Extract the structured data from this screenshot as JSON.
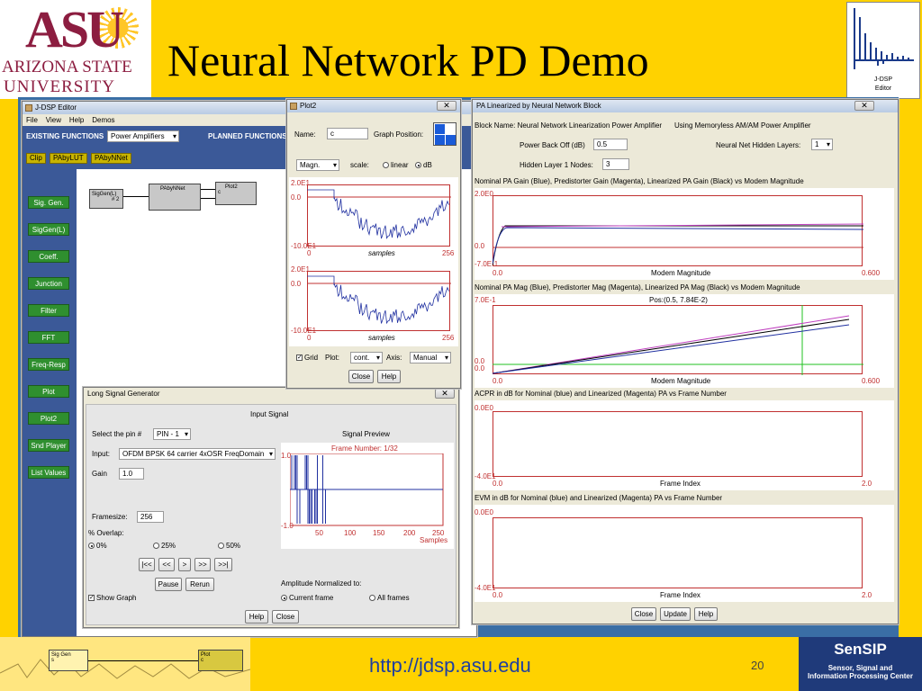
{
  "slide": {
    "title": "Neural Network PD Demo",
    "url": "http://jdsp.asu.edu",
    "page_number": "20"
  },
  "logos": {
    "asu_mark": "ASU",
    "asu_line1": "ARIZONA STATE",
    "asu_line2": "UNIVERSITY",
    "jdsp_line1": "J-DSP",
    "jdsp_line2": "Editor",
    "sensip_mark": "SenSIP",
    "sensip_line1": "Sensor, Signal and",
    "sensip_line2": "Information Processing Center"
  },
  "footer_strip": {
    "block1_name": "Sig Gen",
    "block1_sub": "s",
    "block2_name": "Plot",
    "block2_sub": "c"
  },
  "editor": {
    "title": "J-DSP Editor",
    "menu": [
      "File",
      "View",
      "Help",
      "Demos"
    ],
    "existing_label": "EXISTING FUNCTIONS",
    "function_select": "Power Amplifiers",
    "planned_label": "PLANNED FUNCTIONS",
    "tools": [
      "Clip",
      "PAbyLUT",
      "PAbyNNet"
    ],
    "sidebar": [
      "Sig. Gen.",
      "SigGen(L)",
      "Coeff.",
      "Junction",
      "Filter",
      "FFT",
      "Freq-Resp",
      "Plot",
      "Plot2",
      "Snd Player",
      "List Values"
    ],
    "blocks": {
      "siggen": "SigGen(L)",
      "siggen_pin": "# 2",
      "pabynnet": "PAbyNNet",
      "plot2": "Plot2",
      "plot2_sub": "c"
    }
  },
  "plot2": {
    "title": "Plot2",
    "name_label": "Name:",
    "name_value": "c",
    "graph_position_label": "Graph Position:",
    "mode_select": "Magn.",
    "scale_label": "scale:",
    "scale_options": [
      "linear",
      "dB"
    ],
    "scale_selected": "dB",
    "top_y_max": "2.0E1",
    "top_y_mid": "0.0",
    "top_y_min": "-10.0E1",
    "x_start": "0",
    "x_label": "samples",
    "x_end": "256",
    "grid_label": "Grid",
    "plot_label": "Plot:",
    "plot_select": "cont.",
    "axis_label": "Axis:",
    "axis_select": "Manual",
    "close": "Close",
    "help": "Help"
  },
  "pa_window": {
    "title": "PA Linearized by Neural Network Block",
    "block_name": "Block Name: Neural Network Linearization Power Amplifier",
    "using": "Using Memoryless AM/AM Power Amplifier",
    "power_backoff_label": "Power Back Off (dB)",
    "power_backoff_value": "0.5",
    "hidden_layers_label": "Neural Net Hidden Layers:",
    "hidden_layers_value": "1",
    "hidden_nodes_label": "Hidden Layer 1 Nodes:",
    "hidden_nodes_value": "3",
    "plots": [
      {
        "title": "Nominal PA Gain (Blue), Predistorter Gain (Magenta), Linearized PA Gain (Black) vs Modem Magnitude",
        "ymax": "2.0E0",
        "ymid": "0.0",
        "ymin": "-7.0E-1",
        "xstart": "0.0",
        "xlabel": "Modem Magnitude",
        "xend": "0.600"
      },
      {
        "title": "Nominal PA Mag (Blue), Predistorter Mag (Magenta), Linearized PA Mag (Black) vs Modem Magnitude",
        "ymax": "7.0E-1",
        "ymid": "0.0",
        "ymin": "0.0",
        "xstart": "0.0",
        "xlabel": "Modem Magnitude",
        "xend": "0.600",
        "cursor": "Pos:(0.5, 7.84E-2)"
      },
      {
        "title": "ACPR in dB for Nominal (blue) and Linearized (Magenta) PA vs Frame Number",
        "ymax": "0.0E0",
        "ymin": "-4.0E1",
        "xstart": "0.0",
        "xlabel": "Frame Index",
        "xend": "2.0"
      },
      {
        "title": "EVM in dB for Nominal (blue) and Linearized (Magenta) PA vs Frame Number",
        "ymax": "0.0E0",
        "ymin": "-4.0E1",
        "xstart": "0.0",
        "xlabel": "Frame Index",
        "xend": "2.0"
      }
    ],
    "close": "Close",
    "update": "Update",
    "help": "Help"
  },
  "lsg": {
    "title": "Long Signal Generator",
    "input_signal": "Input Signal",
    "select_pin_label": "Select the pin #",
    "pin_value": "PIN - 1",
    "signal_preview": "Signal Preview",
    "input_label": "Input:",
    "input_value": "OFDM BPSK 64 carrier 4xOSR FreqDomain",
    "frame_number": "Frame Number: 1/32",
    "gain_label": "Gain",
    "gain_value": "1.0",
    "framesize_label": "Framesize:",
    "framesize_value": "256",
    "overlap_label": "% Overlap:",
    "overlap_options": [
      "0%",
      "25%",
      "50%"
    ],
    "nav": [
      "|<<",
      "<<",
      ">",
      ">>",
      ">>|"
    ],
    "pause": "Pause",
    "rerun": "Rerun",
    "show_graph": "Show Graph",
    "amp_norm_label": "Amplitude Normalized to:",
    "amp_options": [
      "Current frame",
      "All frames"
    ],
    "y_top": "1.0",
    "y_bottom": "-1.0",
    "x_ticks": [
      "50",
      "100",
      "150",
      "200",
      "250"
    ],
    "x_label": "Samples",
    "help": "Help",
    "close": "Close"
  },
  "colors": {
    "asu_maroon": "#8c1d40",
    "asu_gold": "#ffc627",
    "plot_axis": "#c03030",
    "blue_trace": "#2030a0",
    "magenta": "#c040c0"
  }
}
